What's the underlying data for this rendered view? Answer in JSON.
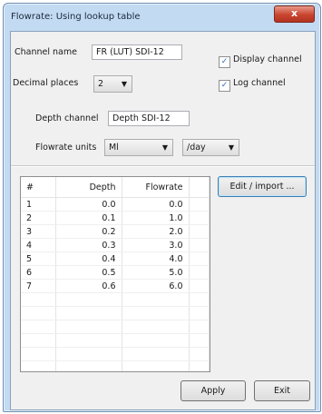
{
  "window": {
    "title": "Flowrate: Using lookup table",
    "close_glyph": "x"
  },
  "channel_name": {
    "label": "Channel name",
    "value": "FR (LUT) SDI-12"
  },
  "decimal_places": {
    "label": "Decimal places",
    "value": "2"
  },
  "display_channel": {
    "label": "Display channel",
    "checked": true
  },
  "log_channel": {
    "label": "Log channel",
    "checked": true
  },
  "depth_channel": {
    "label": "Depth channel",
    "value": "Depth SDI-12"
  },
  "flowrate_units": {
    "label": "Flowrate units",
    "volume": "Ml",
    "per": "/day"
  },
  "table": {
    "columns": [
      "#",
      "Depth",
      "Flowrate"
    ],
    "rows": [
      [
        "1",
        "0.0",
        "0.0"
      ],
      [
        "2",
        "0.1",
        "1.0"
      ],
      [
        "3",
        "0.2",
        "2.0"
      ],
      [
        "4",
        "0.3",
        "3.0"
      ],
      [
        "5",
        "0.4",
        "4.0"
      ],
      [
        "6",
        "0.5",
        "5.0"
      ],
      [
        "7",
        "0.6",
        "6.0"
      ]
    ],
    "empty_rows": 7
  },
  "buttons": {
    "edit_import": "Edit / import ...",
    "apply": "Apply",
    "exit": "Exit"
  },
  "colors": {
    "frame": "#c2daf2",
    "client": "#f0f0f0",
    "close": "#c9442f",
    "check": "#2b6fbf"
  }
}
